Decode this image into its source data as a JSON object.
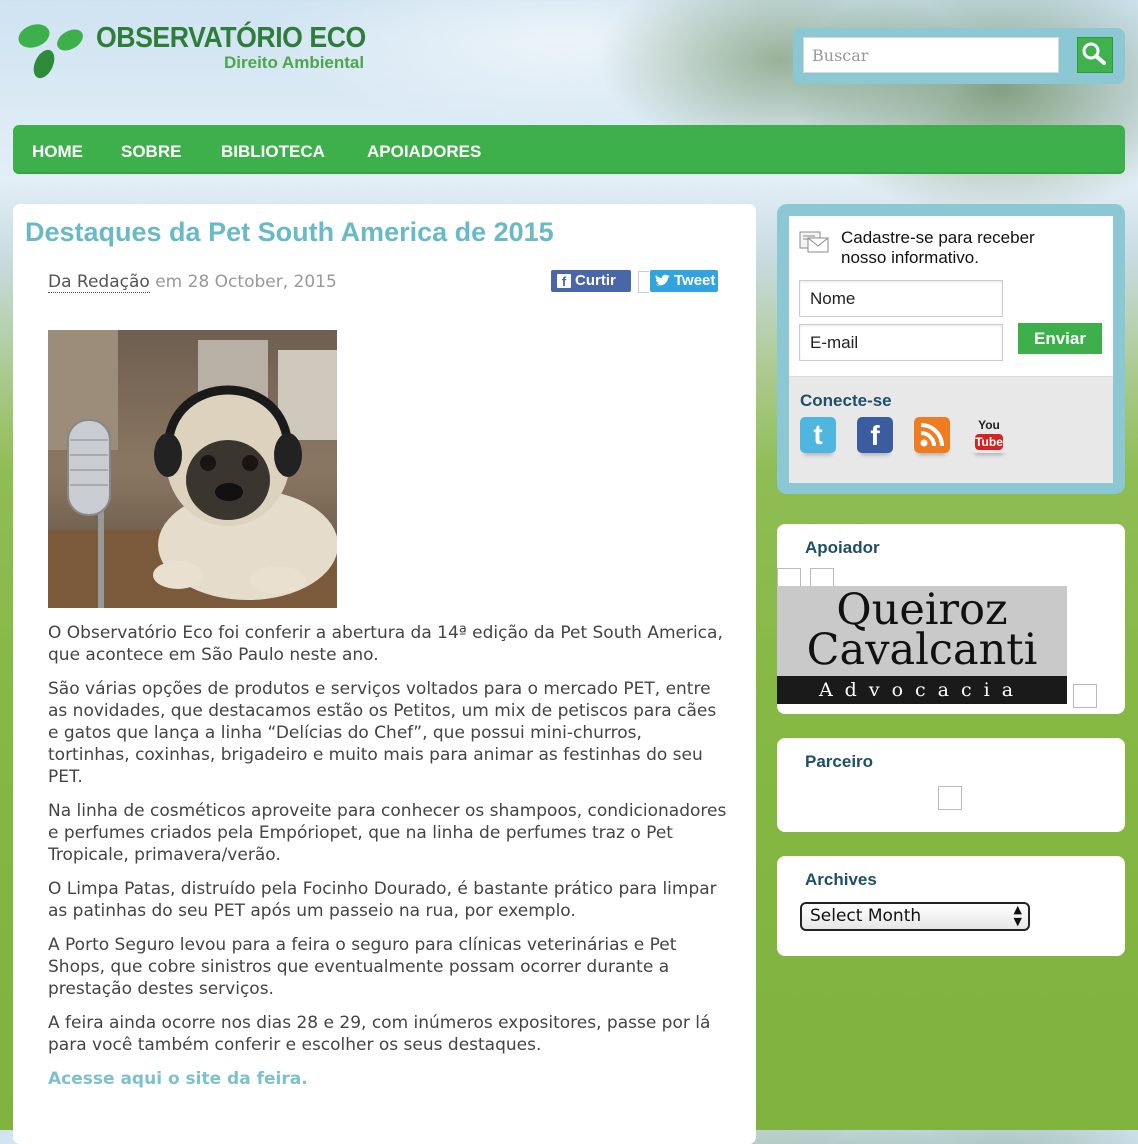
{
  "logo": {
    "title": "OBSERVATÓRIO ECO",
    "subtitle": "Direito Ambiental",
    "icon": "leaf-logo-icon",
    "brand_color": "#2e7d3a"
  },
  "search": {
    "placeholder": "Buscar",
    "button_icon": "search-icon"
  },
  "nav": {
    "items": [
      {
        "label": "HOME"
      },
      {
        "label": "SOBRE"
      },
      {
        "label": "BIBLIOTECA"
      },
      {
        "label": "APOIADORES"
      }
    ],
    "color": "#3db04b"
  },
  "post": {
    "title": "Destaques da Pet South America de 2015",
    "author": "Da Redação",
    "date_prefix": "em",
    "date": "28 October, 2015",
    "share": {
      "facebook_label": "Curtir",
      "twitter_label": "Tweet"
    },
    "image_icon": "pug-with-headphones-image",
    "paragraphs": [
      "O Observatório Eco foi conferir a abertura da 14ª edição da Pet South America, que acontece em São Paulo neste ano.",
      "São várias opções de produtos e serviços voltados para o mercado PET, entre as novidades, que destacamos estão os Petitos, um mix de petiscos para cães e gatos que lança a linha “Delícias do Chef”, que possui mini-churros, tortinhas, coxinhas, brigadeiro e muito mais para animar as festinhas do seu PET.",
      "Na linha de cosméticos aproveite para conhecer os shampoos, condicionadores e perfumes criados pela Empóriopet, que na linha de perfumes traz o Pet Tropicale, primavera/verão.",
      "O Limpa Patas, distruído pela Focinho Dourado, é bastante prático para limpar as patinhas do seu PET após um passeio na rua, por exemplo.",
      "A Porto Seguro levou para a feira o seguro para clínicas veterinárias e Pet Shops, que cobre sinistros que eventualmente possam ocorrer durante a prestação destes serviços.",
      "A feira ainda ocorre nos dias 28 e 29, com inúmeros expositores, passe por lá para você também conferir e escolher os seus destaques."
    ],
    "link_text": "Acesse aqui o site da feira.",
    "title_color": "#6ab9c6"
  },
  "newsletter": {
    "text_line1": "Cadastre-se para receber",
    "text_line2": "nosso informativo.",
    "icon": "newsletter-mail-icon",
    "name_placeholder": "Nome",
    "email_placeholder": "E-mail",
    "submit_label": "Enviar",
    "connect_title": "Conecte-se",
    "social": [
      {
        "name": "twitter-icon",
        "glyph": "t",
        "color": "#4fb6e0"
      },
      {
        "name": "facebook-icon",
        "glyph": "f",
        "color": "#3b5c9e"
      },
      {
        "name": "rss-icon",
        "glyph": "))",
        "color": "#f07c22"
      },
      {
        "name": "youtube-icon",
        "glyph": "You Tube",
        "color": "#d8d8d8"
      }
    ]
  },
  "sponsor": {
    "title": "Apoiador",
    "logo_line1": "Queiroz",
    "logo_line2": "Cavalcanti",
    "logo_line3": "Advocacia"
  },
  "partner": {
    "title": "Parceiro"
  },
  "archives": {
    "title": "Archives",
    "selected": "Select Month"
  }
}
